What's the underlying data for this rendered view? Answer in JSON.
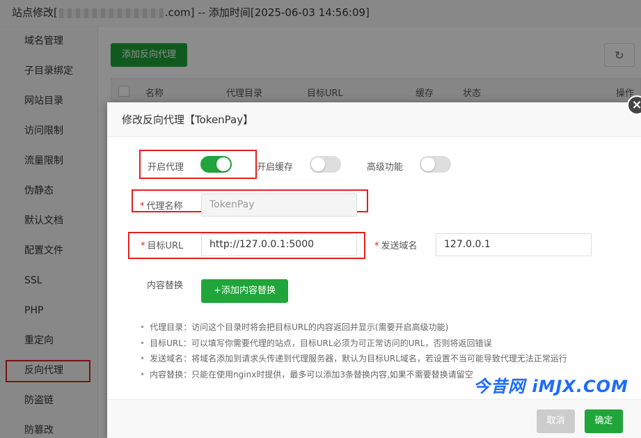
{
  "window": {
    "title_prefix": "站点修改[",
    "title_suffix": ".com] -- 添加时间[2025-06-03 14:56:09]"
  },
  "sidebar": {
    "items": [
      {
        "label": "域名管理"
      },
      {
        "label": "子目录绑定"
      },
      {
        "label": "网站目录"
      },
      {
        "label": "访问限制"
      },
      {
        "label": "流量限制"
      },
      {
        "label": "伪静态"
      },
      {
        "label": "默认文档"
      },
      {
        "label": "配置文件"
      },
      {
        "label": "SSL"
      },
      {
        "label": "PHP"
      },
      {
        "label": "重定向"
      },
      {
        "label": "反向代理"
      },
      {
        "label": "防盗链"
      },
      {
        "label": "防篡改"
      }
    ],
    "active_index": 11
  },
  "main": {
    "add_button": "添加反向代理",
    "table_headers": [
      "名称",
      "代理目录",
      "目标URL",
      "缓存",
      "状态",
      "操作"
    ]
  },
  "modal": {
    "title": "修改反向代理【TokenPay】",
    "enable_proxy_label": "开启代理",
    "enable_proxy_on": true,
    "enable_cache_label": "开启缓存",
    "enable_cache_on": false,
    "advanced_label": "高级功能",
    "advanced_on": false,
    "required_mark": "*",
    "proxy_name_label": "代理名称",
    "proxy_name_value": "TokenPay",
    "target_url_label": "目标URL",
    "target_url_value": "http://127.0.0.1:5000",
    "send_domain_label": "发送域名",
    "send_domain_value": "127.0.0.1",
    "content_replace_label": "内容替换",
    "add_content_button": "+添加内容替换",
    "tips": [
      "代理目录：访问这个目录时将会把目标URL的内容返回并显示(需要开启高级功能)",
      "目标URL：可以填写你需要代理的站点，目标URL必须为可正常访问的URL，否则将返回错误",
      "发送域名：将域名添加到请求头传递到代理服务器，默认为目标URL域名，若设置不当可能导致代理无法正常运行",
      "内容替换：只能在使用nginx时提供，最多可以添加3条替换内容,如果不需要替换请留空"
    ],
    "cancel_button": "取消",
    "ok_button": "确定",
    "close_symbol": "×"
  },
  "watermark": "今昔网 iMJX.COM",
  "colors": {
    "accent": "#20a53a",
    "highlight_border": "#e02020",
    "watermark": "#1e6cff"
  }
}
